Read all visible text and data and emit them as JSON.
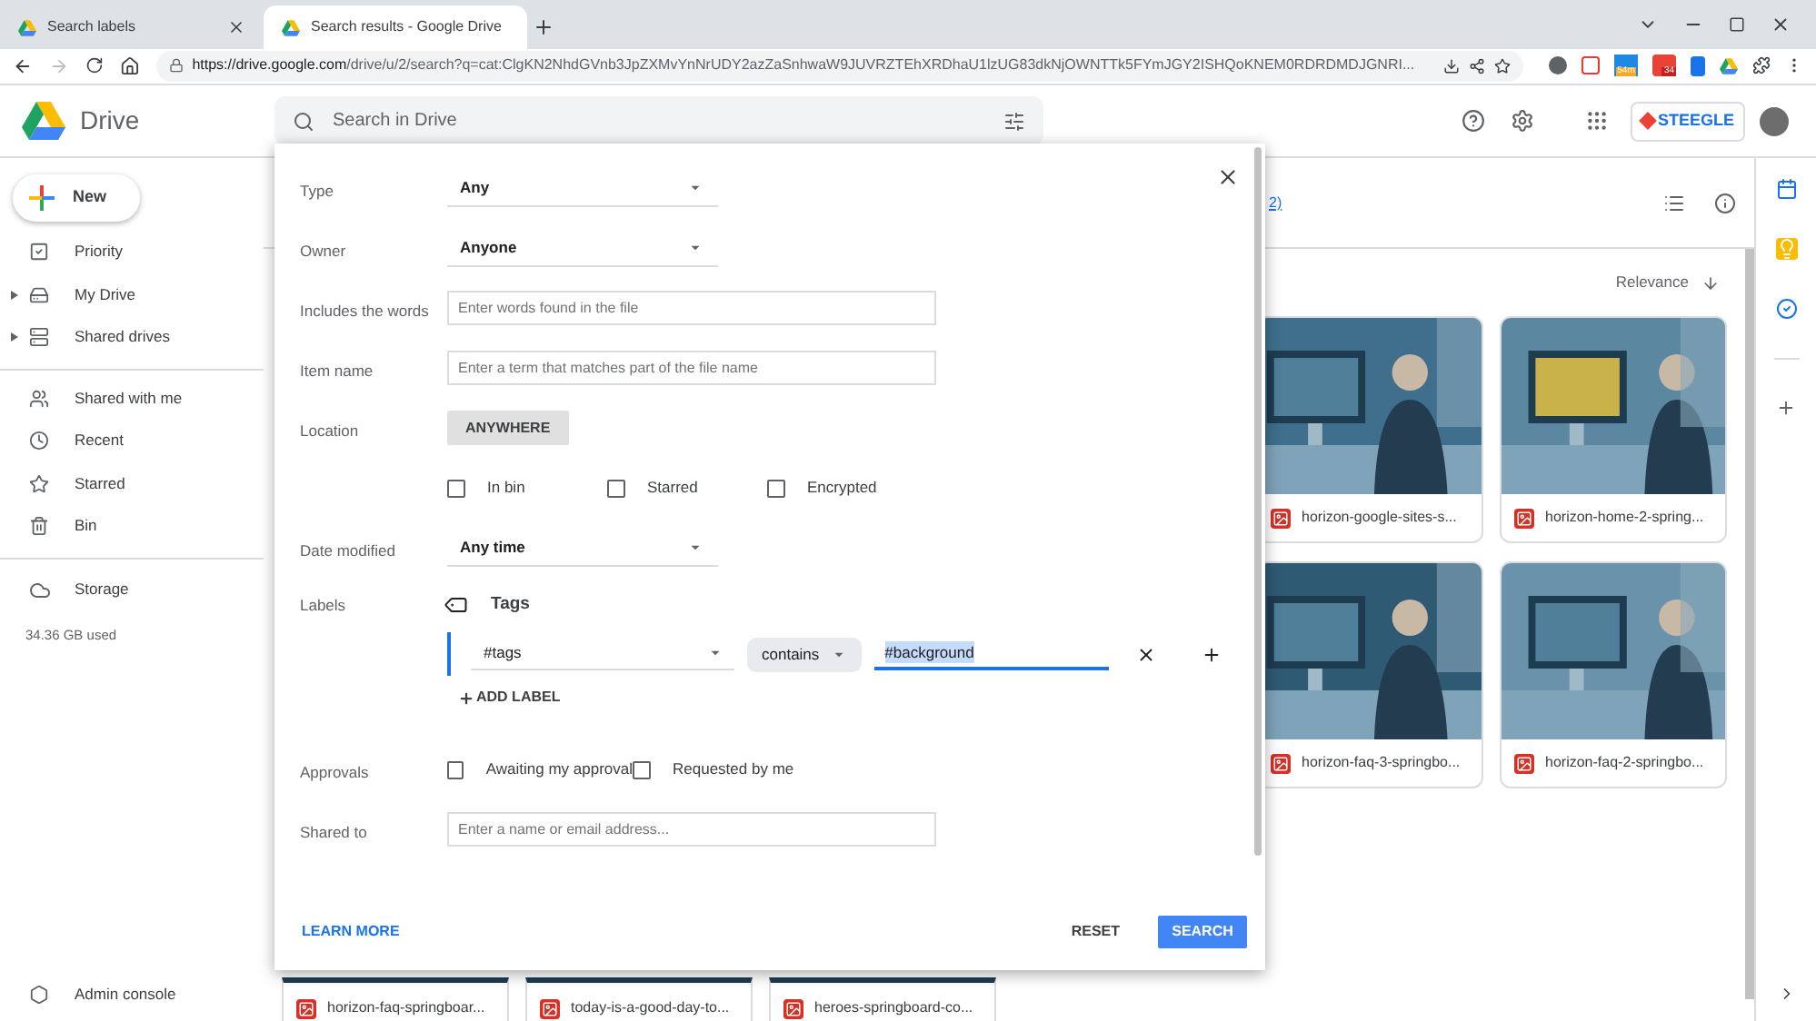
{
  "browser": {
    "tabs": [
      {
        "title": "Search labels",
        "selected": false
      },
      {
        "title": "Search results - Google Drive",
        "selected": true
      }
    ],
    "url_host": "https://drive.google.com",
    "url_path": "/drive/u/2/search?q=cat:ClgKN2NhdGVnb3JpZXMvYnNrUDY2azZaSnhwaW9JUVRZTEhXRDhaU1lzUG83dkNjOWNTTk5FYmJGY2ISHQoKNEM0RDRDMDJGNRI...",
    "extension_badges": [
      "54m",
      "34"
    ]
  },
  "app": {
    "name": "Drive",
    "search_placeholder": "Search in Drive",
    "brand": "STEEGLE"
  },
  "sidebar": {
    "new_button": "New",
    "groups": [
      [
        {
          "label": "Priority",
          "expandable": false
        },
        {
          "label": "My Drive",
          "expandable": true
        },
        {
          "label": "Shared drives",
          "expandable": true
        }
      ],
      [
        {
          "label": "Shared with me",
          "expandable": false
        },
        {
          "label": "Recent",
          "expandable": false
        },
        {
          "label": "Starred",
          "expandable": false
        },
        {
          "label": "Bin",
          "expandable": false
        }
      ]
    ],
    "storage": {
      "label": "Storage",
      "used": "34.36 GB used"
    },
    "admin": "Admin console"
  },
  "results": {
    "partial_link": "2)",
    "sort": "Relevance",
    "files": [
      {
        "name": "horizon-google-sites-s..."
      },
      {
        "name": "horizon-home-2-spring..."
      },
      {
        "name": "horizon-faq-3-springbo..."
      },
      {
        "name": "horizon-faq-2-springbo..."
      },
      {
        "name": "horizon-faq-springboar..."
      },
      {
        "name": "today-is-a-good-day-to..."
      },
      {
        "name": "heroes-springboard-co..."
      }
    ]
  },
  "dialog": {
    "rows": [
      {
        "kind": "select",
        "label": "Type",
        "value": "Any"
      },
      {
        "kind": "select",
        "label": "Owner",
        "value": "Anyone"
      },
      {
        "kind": "text",
        "label": "Includes the words",
        "placeholder": "Enter words found in the file"
      },
      {
        "kind": "text",
        "label": "Item name",
        "placeholder": "Enter a term that matches part of the file name"
      },
      {
        "kind": "button",
        "label": "Location",
        "value": "ANYWHERE"
      },
      {
        "kind": "checks",
        "options": [
          {
            "label": "In bin",
            "checked": false
          },
          {
            "label": "Starred",
            "checked": false
          },
          {
            "label": "Encrypted",
            "checked": false
          }
        ]
      },
      {
        "kind": "select",
        "label": "Date modified",
        "value": "Any time"
      },
      {
        "kind": "labels",
        "label": "Labels",
        "label_name": "Tags",
        "field": "#tags",
        "operator": "contains",
        "value": "#background",
        "add": "ADD LABEL"
      },
      {
        "kind": "checks",
        "label": "Approvals",
        "options": [
          {
            "label": "Awaiting my approval",
            "checked": false
          },
          {
            "label": "Requested by me",
            "checked": false
          }
        ]
      },
      {
        "kind": "text",
        "label": "Shared to",
        "placeholder": "Enter a name or email address..."
      }
    ],
    "learn_more": "LEARN MORE",
    "reset": "RESET",
    "search": "SEARCH"
  }
}
